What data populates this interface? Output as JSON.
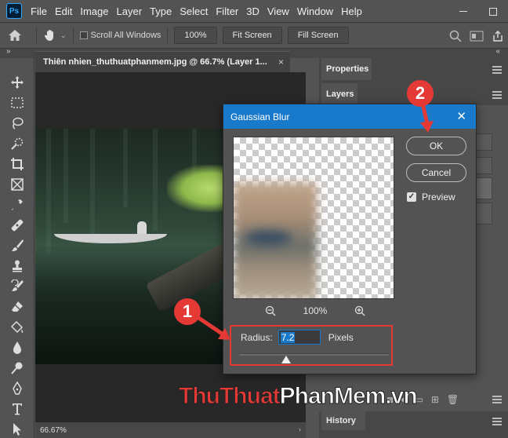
{
  "app": {
    "logo": "Ps"
  },
  "menu": [
    "File",
    "Edit",
    "Image",
    "Layer",
    "Type",
    "Select",
    "Filter",
    "3D",
    "View",
    "Window",
    "Help"
  ],
  "options_bar": {
    "scroll_all_windows": "Scroll All Windows",
    "zoom_value": "100%",
    "fit_screen": "Fit Screen",
    "fill_screen": "Fill Screen"
  },
  "document": {
    "tab_title": "Thiên nhien_thuthuatphanmem.jpg @ 66.7% (Layer 1...",
    "close": "×",
    "status_zoom": "66.67%"
  },
  "panels": {
    "properties": "Properties",
    "layers": "Layers",
    "history": "History"
  },
  "dialog": {
    "title": "Gaussian Blur",
    "close": "✕",
    "ok": "OK",
    "cancel": "Cancel",
    "preview_label": "Preview",
    "preview_checked": true,
    "zoom_out": "−",
    "zoom_in": "+",
    "zoom_level": "100%",
    "radius_label": "Radius:",
    "radius_value": "7.2",
    "radius_unit": "Pixels"
  },
  "annotations": {
    "step1": "1",
    "step2": "2",
    "accent_color": "#e53935"
  },
  "watermark": {
    "part_a": "ThuThuat",
    "part_b": "PhanMem",
    "part_c": ".vn"
  },
  "colors": {
    "titlebar": "#1979ca",
    "workspace": "#535353",
    "panel_dark": "#474747"
  }
}
